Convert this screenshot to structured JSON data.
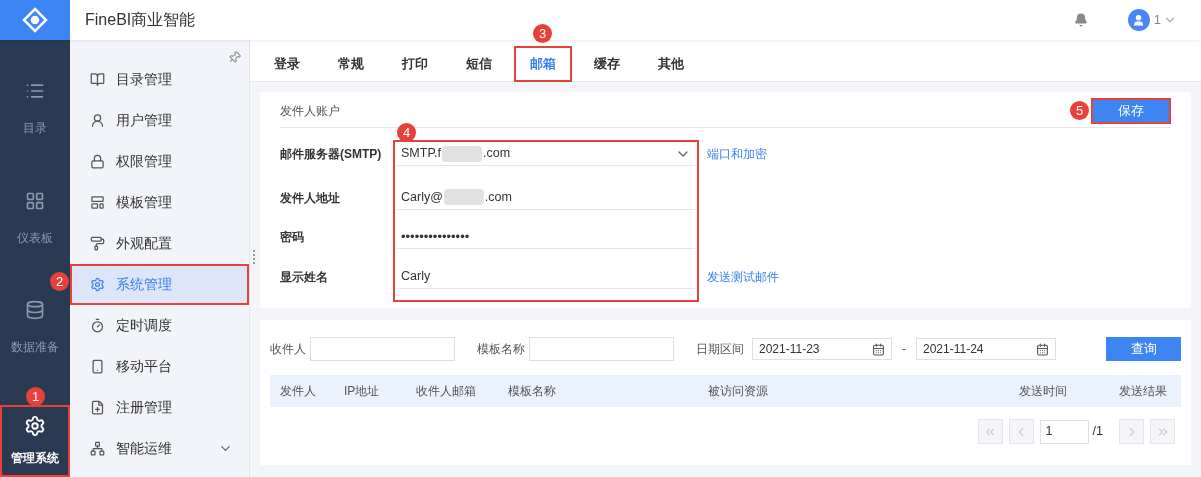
{
  "header": {
    "title": "FineBI商业智能",
    "user": "1"
  },
  "rail": [
    {
      "kind": "list",
      "label": "目录",
      "selected": false,
      "highlight": false
    },
    {
      "kind": "dashboard",
      "label": "仪表板",
      "selected": false,
      "highlight": false
    },
    {
      "kind": "data",
      "label": "数据准备",
      "selected": false,
      "highlight": false
    },
    {
      "kind": "gear",
      "label": "管理系统",
      "selected": true,
      "callout": "1",
      "highlight": true
    }
  ],
  "sidebar": [
    {
      "kind": "catalog",
      "label": "目录管理",
      "selected": false,
      "highlight": false
    },
    {
      "kind": "user",
      "label": "用户管理",
      "selected": false,
      "highlight": false
    },
    {
      "kind": "lock",
      "label": "权限管理",
      "selected": false,
      "highlight": false
    },
    {
      "kind": "template",
      "label": "模板管理",
      "selected": false,
      "highlight": false
    },
    {
      "kind": "brush",
      "label": "外观配置",
      "selected": false,
      "highlight": false
    },
    {
      "kind": "gear",
      "label": "系统管理",
      "selected": true,
      "highlight": true,
      "callout": "2"
    },
    {
      "kind": "timer",
      "label": "定时调度",
      "selected": false,
      "highlight": false
    },
    {
      "kind": "mobile",
      "label": "移动平台",
      "selected": false,
      "highlight": false
    },
    {
      "kind": "register",
      "label": "注册管理",
      "selected": false,
      "highlight": false
    },
    {
      "kind": "ops",
      "label": "智能运维",
      "selected": false,
      "highlight": false,
      "expandable": true
    }
  ],
  "tabs": [
    {
      "label": "登录",
      "selected": false,
      "highlight": false
    },
    {
      "label": "常规",
      "selected": false,
      "highlight": false
    },
    {
      "label": "打印",
      "selected": false,
      "highlight": false
    },
    {
      "label": "短信",
      "selected": false,
      "highlight": false
    },
    {
      "label": "邮箱",
      "selected": true,
      "callout": "3",
      "highlight": true
    },
    {
      "label": "缓存",
      "selected": false,
      "highlight": false
    },
    {
      "label": "其他",
      "selected": false,
      "highlight": false
    }
  ],
  "sender_account": {
    "heading": "发件人账户",
    "save_button": {
      "label": "保存",
      "callout": "5"
    },
    "fields_callout": "4",
    "fields": [
      {
        "kind": "select",
        "label": "邮件服务器(SMTP)",
        "value": "SMTP.f",
        "value_suffix": ".com",
        "link": "端口和加密"
      },
      {
        "kind": "text",
        "label": "发件人地址",
        "value": "Carly@",
        "value_suffix": ".com"
      },
      {
        "kind": "password",
        "label": "密码",
        "value": "•••••••••••••••"
      },
      {
        "kind": "text",
        "label": "显示姓名",
        "value": "Carly",
        "link": "发送测试邮件"
      }
    ]
  },
  "log": {
    "filters": {
      "recipient_label": "收件人",
      "template_label": "模板名称",
      "date_label": "日期区间",
      "date_from": "2021-11-23",
      "date_sep": "-",
      "date_to": "2021-11-24",
      "query_button": "查询"
    },
    "columns": [
      "发件人",
      "IP地址",
      "收件人邮箱",
      "模板名称",
      "被访问资源",
      "发送时间",
      "发送结果"
    ],
    "pagination": {
      "page": "1",
      "total": "/1"
    }
  }
}
